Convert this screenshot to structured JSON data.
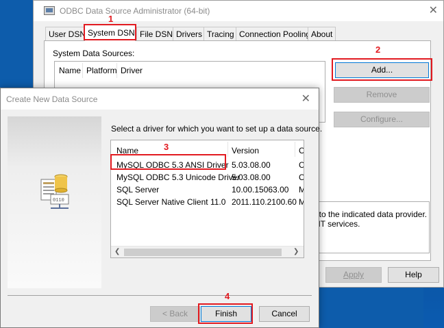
{
  "main_window": {
    "title": "ODBC Data Source Administrator (64-bit)",
    "tabs": [
      {
        "label": "User DSN"
      },
      {
        "label": "System DSN"
      },
      {
        "label": "File DSN"
      },
      {
        "label": "Drivers"
      },
      {
        "label": "Tracing"
      },
      {
        "label": "Connection Pooling"
      },
      {
        "label": "About"
      }
    ],
    "active_tab": "System DSN",
    "system_sources_label": "System Data Sources:",
    "columns": [
      "Name",
      "Platform",
      "Driver"
    ],
    "add_button": "Add...",
    "remove_button": "Remove",
    "configure_button": "Configure...",
    "description_line1": "t to the indicated data provider.",
    "description_line2": "NT services.",
    "apply_button": "Apply",
    "help_button": "Help"
  },
  "dialog": {
    "title": "Create New Data Source",
    "prompt": "Select a driver for which you want to set up a data source.",
    "columns": [
      "Name",
      "Version",
      "C"
    ],
    "drivers": [
      {
        "name": "MySQL ODBC 5.3 ANSI Driver",
        "version": "5.03.08.00",
        "extra": "C"
      },
      {
        "name": "MySQL ODBC 5.3 Unicode Driver",
        "version": "5.03.08.00",
        "extra": "C"
      },
      {
        "name": "SQL Server",
        "version": "10.00.15063.00",
        "extra": "M"
      },
      {
        "name": "SQL Server Native Client 11.0",
        "version": "2011.110.2100.60",
        "extra": "M"
      }
    ],
    "back_button": "< Back",
    "finish_button": "Finish",
    "cancel_button": "Cancel"
  },
  "annotations": [
    "1",
    "2",
    "3",
    "4"
  ],
  "colors": {
    "annotation": "#e2191f",
    "desktop": "#0d5cab",
    "focus_border": "#0078d7"
  },
  "icons": [
    "odbc-app-icon",
    "close-icon",
    "data-source-icon",
    "scroll-left-icon",
    "scroll-right-icon"
  ]
}
